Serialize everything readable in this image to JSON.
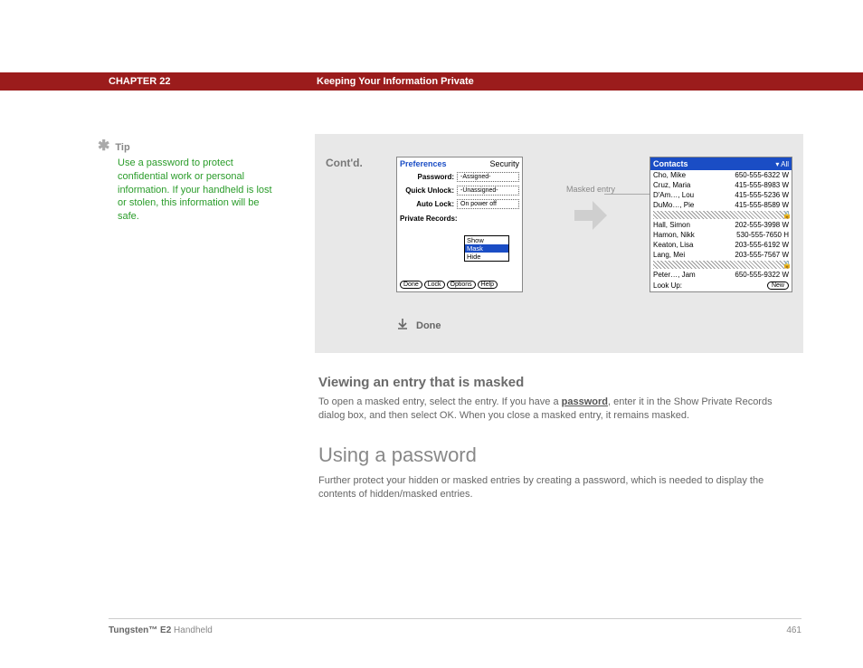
{
  "header": {
    "chapter": "CHAPTER 22",
    "title": "Keeping Your Information Private"
  },
  "tip": {
    "label": "Tip",
    "text": "Use a password to protect confidential work or personal information. If your handheld is lost or stolen, this information will be safe."
  },
  "panel": {
    "contd": "Cont'd.",
    "masked_entry_label": "Masked entry",
    "done": "Done",
    "preferences": {
      "title": "Preferences",
      "subtitle": "Security",
      "password_label": "Password:",
      "password_val": "-Assigned-",
      "quick_label": "Quick Unlock:",
      "quick_val": "-Unassigned-",
      "autolock_label": "Auto Lock:",
      "autolock_val": "On power off",
      "private_label": "Private Records:",
      "opts": {
        "show": "Show",
        "mask": "Mask",
        "hide": "Hide"
      },
      "buttons": {
        "done": "Done",
        "lock": "Lock",
        "options": "Options",
        "help": "Help"
      }
    },
    "contacts": {
      "title": "Contacts",
      "all": "▾ All",
      "rows": [
        {
          "name": "Cho, Mike",
          "phone": "650-555-6322 W"
        },
        {
          "name": "Cruz, Maria",
          "phone": "415-555-8983 W"
        },
        {
          "name": "D'Am…, Lou",
          "phone": "415-555-5236 W"
        },
        {
          "name": "DuMo…, Pie",
          "phone": "415-555-8589 W"
        },
        {
          "name": "Hall, Simon",
          "phone": "202-555-3998 W"
        },
        {
          "name": "Hamon, Nikk",
          "phone": "530-555-7650 H"
        },
        {
          "name": "Keaton, Lisa",
          "phone": "203-555-6192 W"
        },
        {
          "name": "Lang, Mei",
          "phone": "203-555-7567 W"
        },
        {
          "name": "Peter…, Jam",
          "phone": "650-555-9322 W"
        }
      ],
      "lookup": "Look Up:",
      "new": "New"
    }
  },
  "sections": {
    "viewing": {
      "heading": "Viewing an entry that is masked",
      "body_pre": "To open a masked entry, select the entry. If you have a ",
      "link": "password",
      "body_post": ", enter it in the Show Private Records dialog box, and then select OK. When you close a masked entry, it remains masked."
    },
    "using": {
      "heading": "Using a password",
      "body": "Further protect your hidden or masked entries by creating a password, which is needed to display the contents of hidden/masked entries."
    }
  },
  "footer": {
    "product_a": "Tungsten™ E2",
    "product_b": " Handheld",
    "page": "461"
  }
}
